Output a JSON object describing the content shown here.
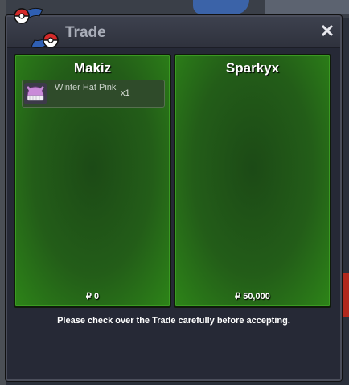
{
  "window": {
    "title": "Trade",
    "close_label": "✕",
    "footer_message": "Please check over the Trade carefully before accepting."
  },
  "left_panel": {
    "player_name": "Makiz",
    "money": "₽ 0",
    "items": [
      {
        "name": "Winter Hat Pink",
        "quantity": "x1",
        "icon": "winter-hat-icon"
      }
    ]
  },
  "right_panel": {
    "player_name": "Sparkyx",
    "money": "₽ 50,000",
    "items": []
  },
  "colors": {
    "panel_green": "#235d18",
    "window_bg": "#262936",
    "title_text": "#a9adb8"
  }
}
